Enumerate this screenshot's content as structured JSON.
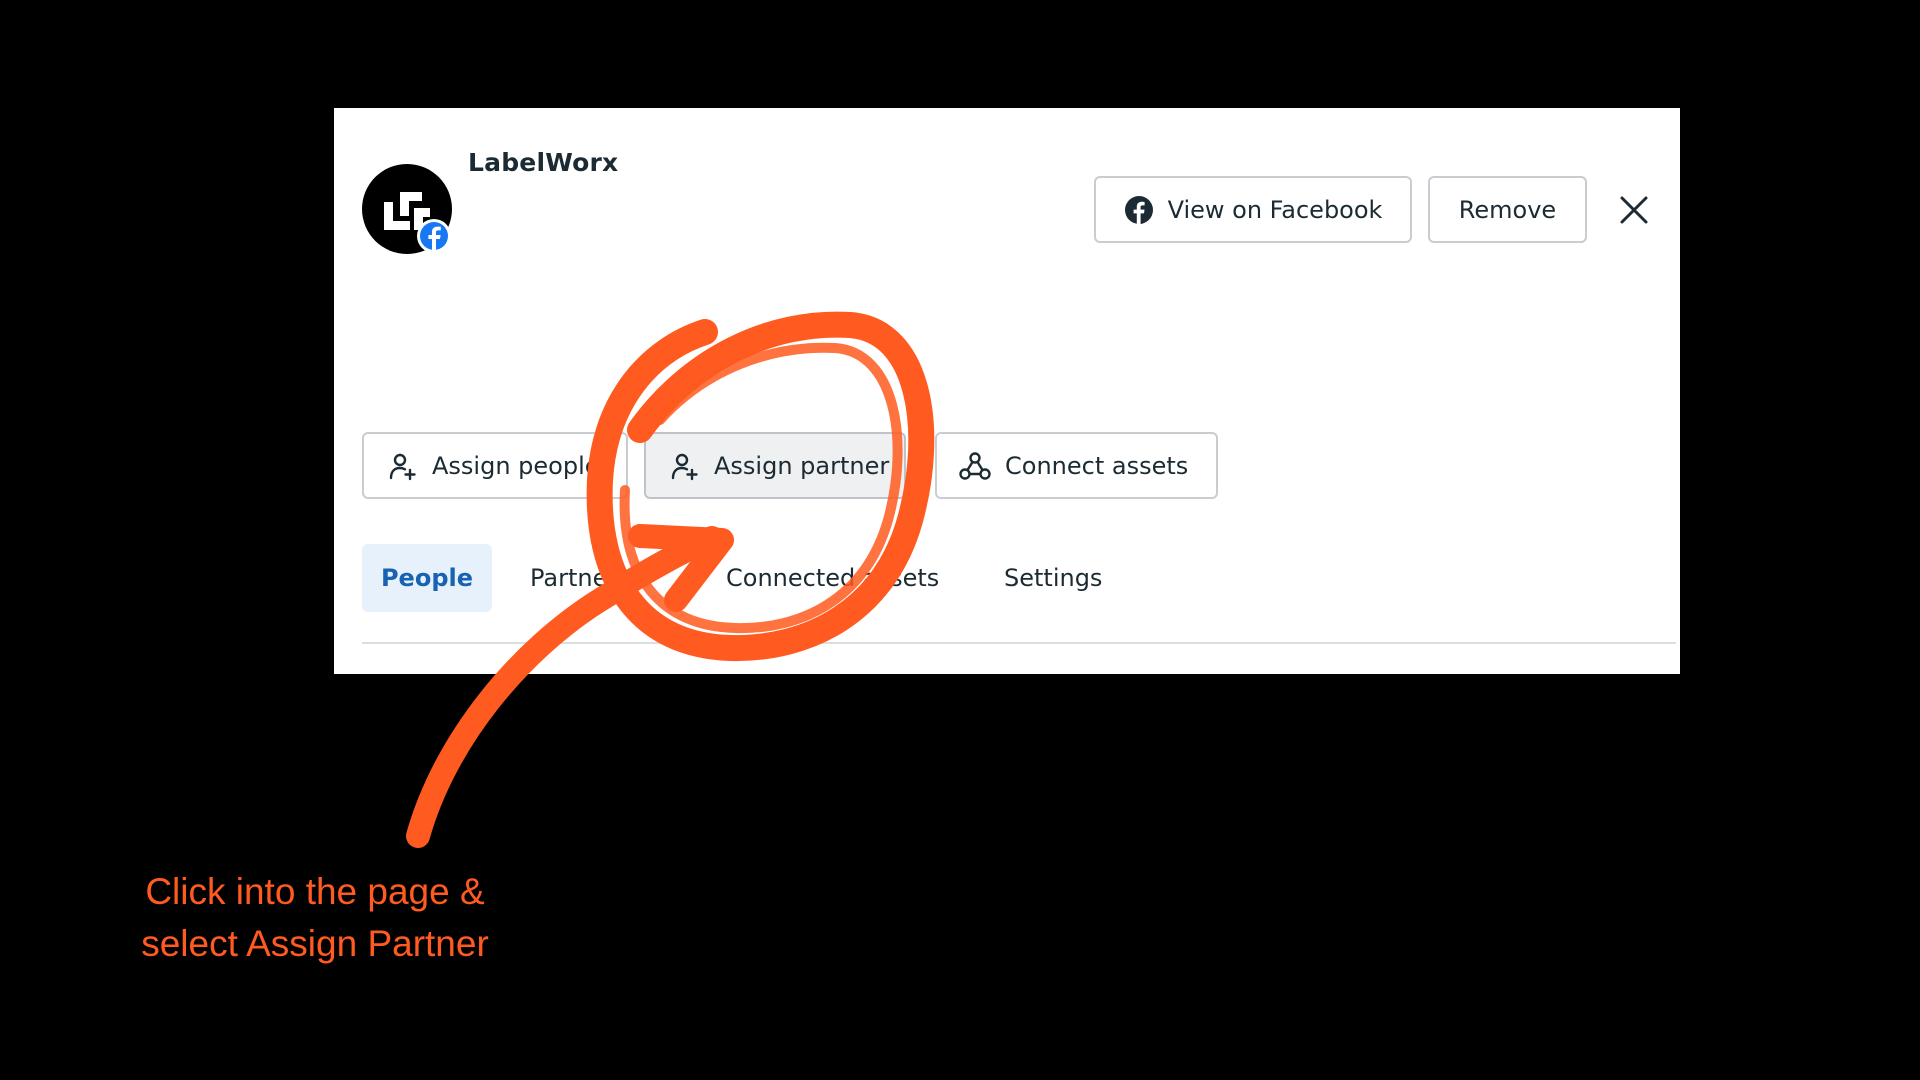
{
  "page": {
    "name": "LabelWorx"
  },
  "header_actions": {
    "view_on_facebook": "View on Facebook",
    "remove": "Remove"
  },
  "actions": {
    "assign_people": "Assign people",
    "assign_partner": "Assign partner",
    "connect_assets": "Connect assets"
  },
  "tabs": [
    {
      "label": "People",
      "selected": true
    },
    {
      "label": "Partners",
      "selected": false
    },
    {
      "label": "Connected assets",
      "selected": false
    },
    {
      "label": "Settings",
      "selected": false
    }
  ],
  "annotation": {
    "line1": "Click into the page &",
    "line2": "select Assign Partner"
  },
  "colors": {
    "accent_annotation": "#ff5a1f",
    "facebook_blue": "#1877f2",
    "selected_tab_bg": "#e6f1fb",
    "selected_tab_text": "#1763b2"
  },
  "icons": {
    "page_avatar": "labelworx-logo-icon",
    "badge": "facebook-badge-icon",
    "view_on_facebook": "facebook-icon",
    "close": "close-icon",
    "assign_people": "person-add-icon",
    "assign_partner": "person-add-icon",
    "connect_assets": "connect-nodes-icon"
  }
}
